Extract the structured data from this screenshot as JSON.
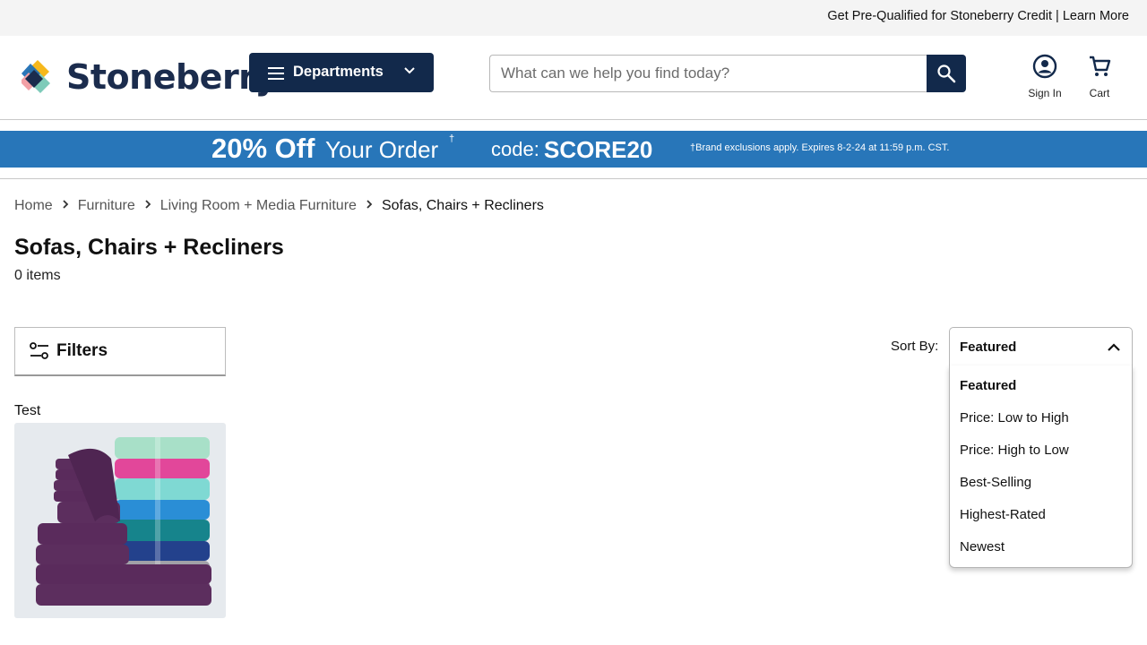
{
  "topbar": {
    "credit_text": "Get Pre-Qualified for Stoneberry Credit",
    "separator": " | ",
    "learn_more": "Learn More"
  },
  "header": {
    "logo_text": "Stoneberry",
    "departments_label": "Departments",
    "search_placeholder": "What can we help you find today?",
    "sign_in_label": "Sign In",
    "cart_label": "Cart"
  },
  "promo": {
    "headline_bold": "20% Off",
    "headline_rest": "Your Order",
    "dagger": "†",
    "code_label": "code:",
    "code_value": "SCORE20",
    "fine_print": "†Brand exclusions apply. Expires 8-2-24 at 11:59 p.m. CST."
  },
  "breadcrumb": {
    "items": [
      "Home",
      "Furniture",
      "Living Room + Media Furniture"
    ],
    "current": "Sofas, Chairs + Recliners"
  },
  "page": {
    "title": "Sofas, Chairs + Recliners",
    "item_count": "0 items"
  },
  "filters": {
    "label": "Filters"
  },
  "product": {
    "title": "Test"
  },
  "sort": {
    "label": "Sort By:",
    "selected": "Featured",
    "options": [
      "Featured",
      "Price: Low to High",
      "Price: High to Low",
      "Best-Selling",
      "Highest-Rated",
      "Newest"
    ]
  },
  "colors": {
    "navy": "#12294b",
    "promo_blue": "#2876b9",
    "topbar_gray": "#f4f4f4"
  }
}
